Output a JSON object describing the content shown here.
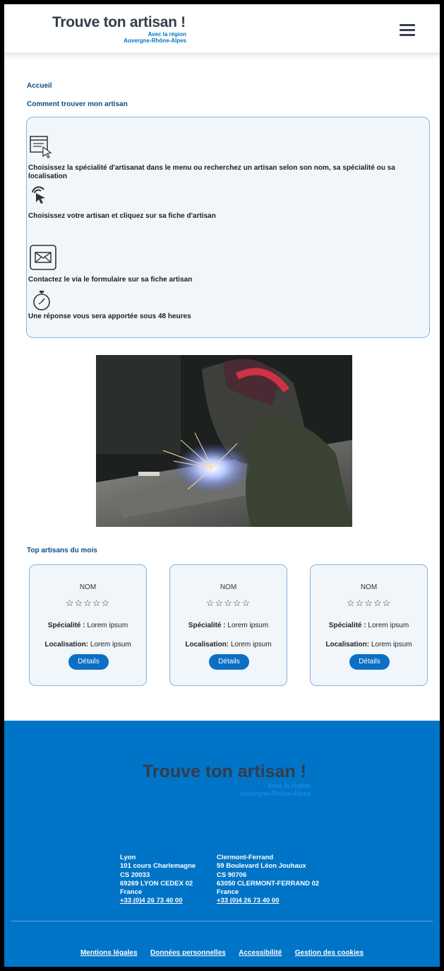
{
  "header": {
    "logo_title": "Trouve ton artisan !",
    "logo_sub_1": "Avec la région",
    "logo_sub_2": "Auvergne-Rhône-Alpes",
    "menu_icon": "hamburger-menu-icon"
  },
  "breadcrumb": "Accueil",
  "how_to": {
    "title": "Comment trouver mon artisan",
    "steps": [
      {
        "icon": "browser-click-icon",
        "text": "Choisissez la spécialité d'artisanat dans le menu ou recherchez un artisan selon son nom, sa spécialité ou sa localisation"
      },
      {
        "icon": "tap-cursor-icon",
        "text": "Choisissez votre artisan et cliquez sur sa fiche d'artisan"
      },
      {
        "icon": "envelope-icon",
        "text": "Contactez le via le formulaire sur sa fiche artisan"
      },
      {
        "icon": "stopwatch-icon",
        "text": "Une réponse vous sera apportée sous 48 heures"
      }
    ]
  },
  "photo": {
    "subject": "welder-photo"
  },
  "top": {
    "title": "Top artisans du mois",
    "cards": [
      {
        "name": "NOM",
        "stars": "☆☆☆☆☆",
        "speciality_label": "Spécialité :",
        "speciality_value": " Lorem ipsum",
        "location_label": "Localisation:",
        "location_value": " Lorem ipsum",
        "button": "Détails"
      },
      {
        "name": "NOM",
        "stars": "☆☆☆☆☆",
        "speciality_label": "Spécialité :",
        "speciality_value": " Lorem ipsum",
        "location_label": "Localisation:",
        "location_value": " Lorem ipsum",
        "button": "Détails"
      },
      {
        "name": "NOM",
        "stars": "☆☆☆☆☆",
        "speciality_label": "Spécialité :",
        "speciality_value": " Lorem ipsum",
        "location_label": "Localisation:",
        "location_value": " Lorem ipsum",
        "button": "Détails"
      }
    ]
  },
  "footer": {
    "logo_title": "Trouve ton artisan !",
    "logo_sub_1": "Avec la région",
    "logo_sub_2": "Auvergne-Rhône-Alpes",
    "addresses": [
      {
        "city": "Lyon",
        "line1": "101 cours Charlemagne",
        "line2": "CS 20033",
        "line3": "69269 LYON CEDEX 02",
        "country": "France",
        "phone": "+33 (0)4 26 73 40 00"
      },
      {
        "city": "Clermont-Ferrand",
        "line1": "59 Boulevard Léon Jouhaux",
        "line2": "CS 90706",
        "line3": "63050 CLERMONT-FERRAND 02",
        "country": "France",
        "phone": "+33 (0)4 26 73 40 00"
      }
    ],
    "links": [
      "Mentions légales",
      "Données personnelles",
      "Accessibilité",
      "Gestion des cookies"
    ]
  },
  "colors": {
    "brand_blue": "#0074c7",
    "dark_text": "#333d4a",
    "card_border": "#82b6e2",
    "card_bg": "#f1f6fb"
  }
}
